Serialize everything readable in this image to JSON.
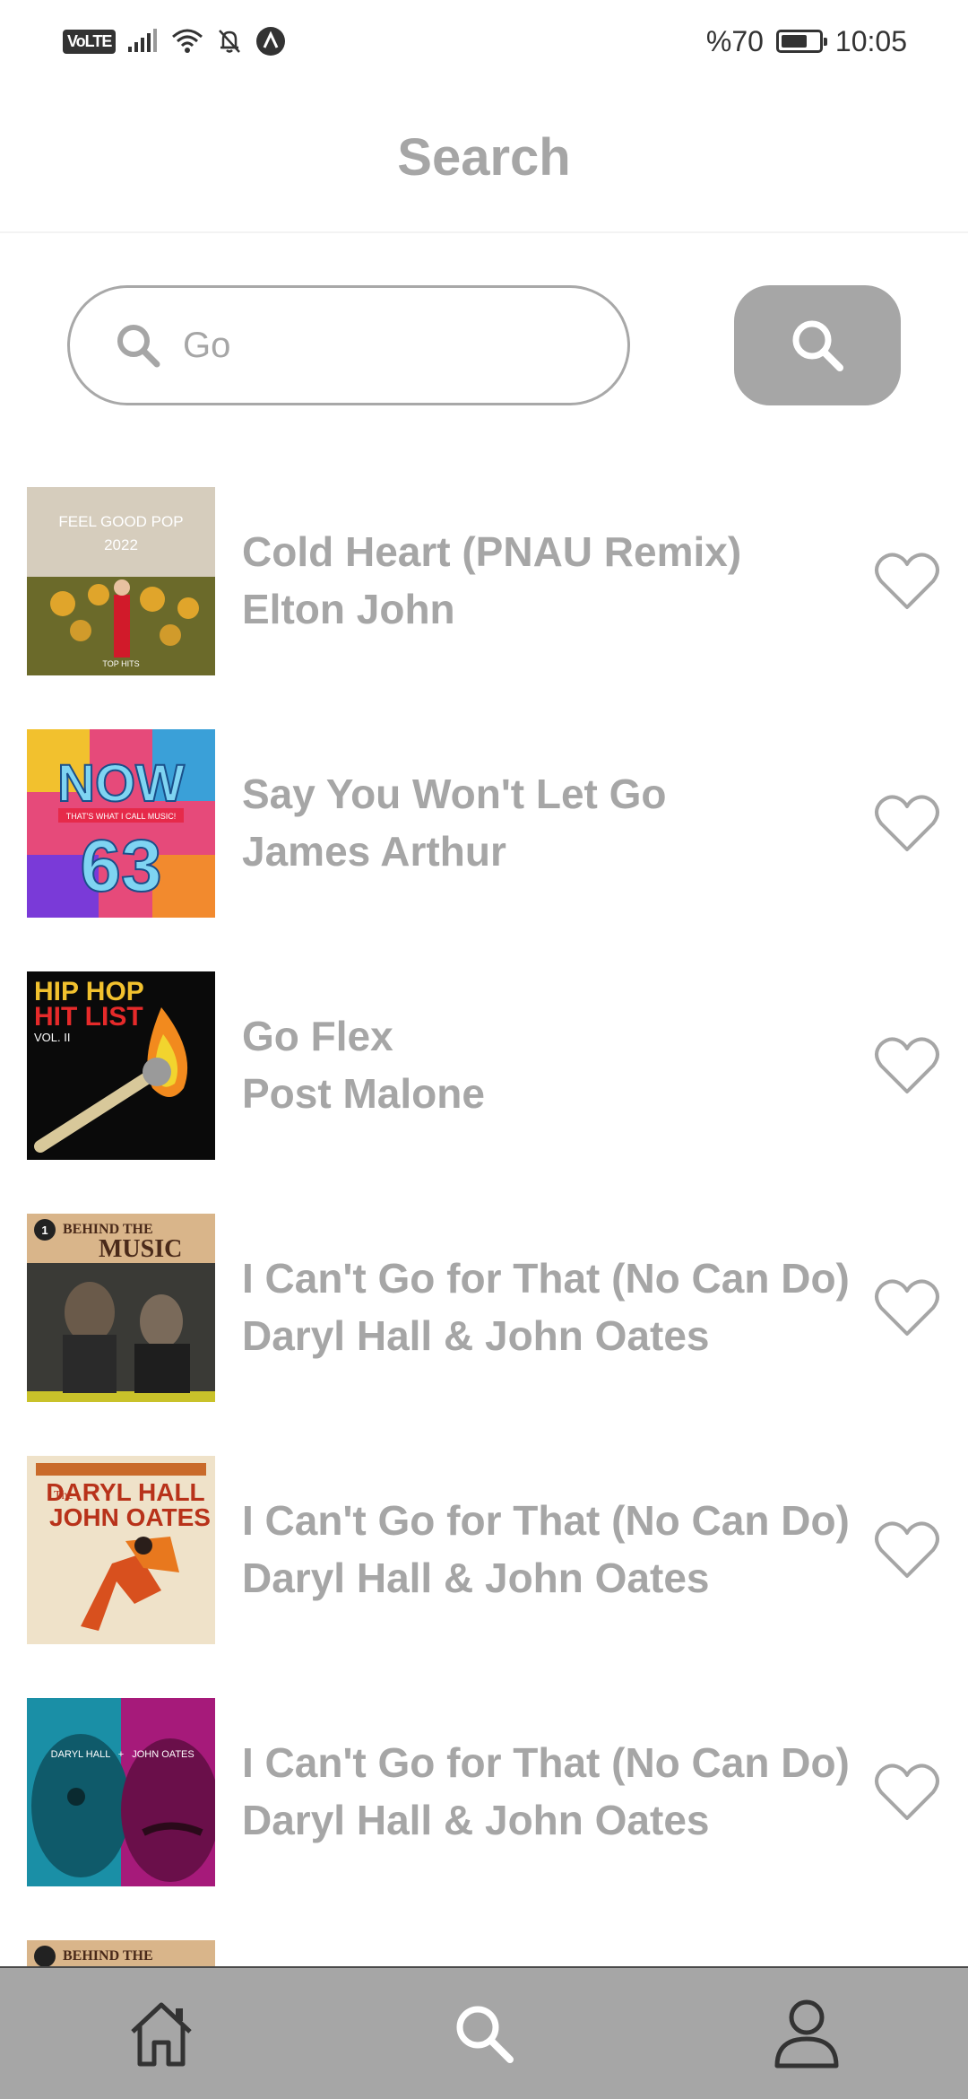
{
  "status_bar": {
    "network": "VoLTE",
    "battery": "%70",
    "battery_level": 0.7,
    "time": "10:05",
    "icons": [
      "volte-icon",
      "signal-icon",
      "wifi-icon",
      "bell-off-icon",
      "app-a-icon",
      "battery-icon"
    ]
  },
  "header": {
    "title": "Search"
  },
  "search": {
    "value": "Go",
    "button_icon": "search-icon"
  },
  "results": [
    {
      "title": "Cold Heart (PNAU Remix)",
      "artist": "Elton John",
      "cover_text_1": "FEEL GOOD POP",
      "cover_text_2": "2022",
      "cover_text_3": "TOP HITS"
    },
    {
      "title": "Say You Won't Let Go",
      "artist": "James Arthur",
      "cover_text_1": "NOW",
      "cover_text_2": "THAT'S WHAT I CALL MUSIC!",
      "cover_text_3": "63"
    },
    {
      "title": "Go Flex",
      "artist": "Post Malone",
      "cover_text_1": "HIP HOP",
      "cover_text_2": "HIT LIST",
      "cover_text_3": "VOL. II"
    },
    {
      "title": "I Can't Go for That (No Can Do)",
      "artist": "Daryl Hall & John Oates",
      "cover_text_1": "BEHIND THE",
      "cover_text_2": "MUSIC",
      "cover_text_3": "1"
    },
    {
      "title": "I Can't Go for That (No Can Do)",
      "artist": "Daryl Hall & John Oates",
      "cover_text_1": "The",
      "cover_text_2": "DARYL HALL",
      "cover_text_3": "JOHN OATES"
    },
    {
      "title": "I Can't Go for That (No Can Do)",
      "artist": "Daryl Hall & John Oates",
      "cover_text_1": "DARYL HALL",
      "cover_text_2": "JOHN OATES",
      "cover_text_3": "+"
    }
  ],
  "partial_row": {
    "cover_text_1": "BEHIND THE"
  },
  "nav": {
    "items": [
      "home-icon",
      "search-icon",
      "profile-icon"
    ]
  },
  "colors": {
    "muted": "#a6a6a6",
    "nav_bg": "#a6a6a6",
    "background": "#ffffff"
  }
}
